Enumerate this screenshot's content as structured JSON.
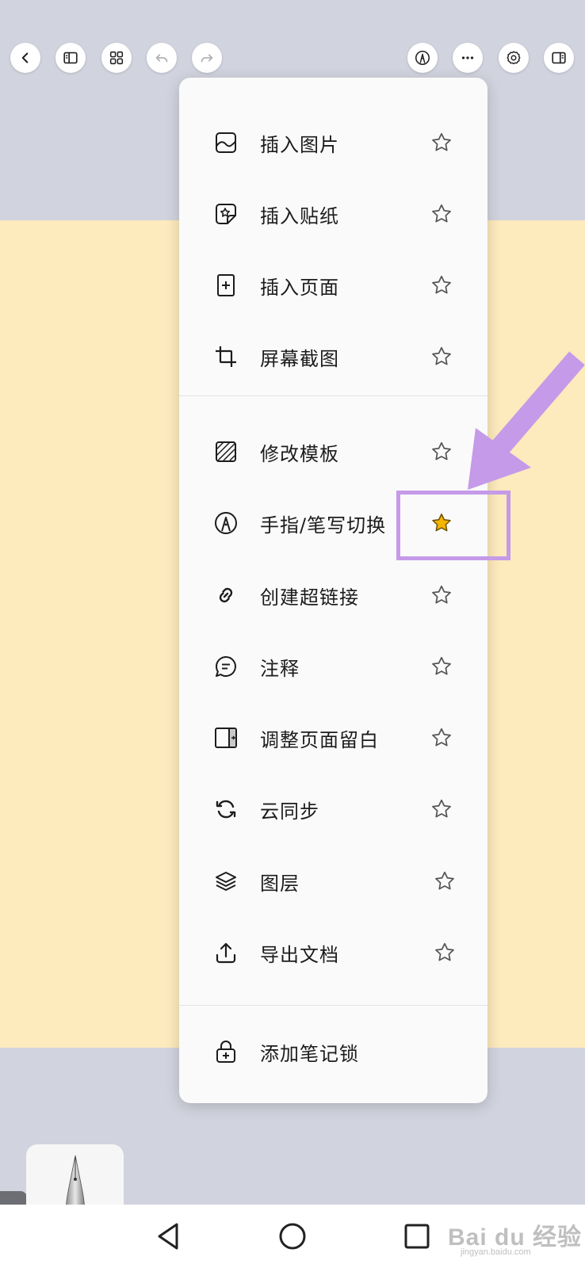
{
  "toolbar": {
    "left_buttons": [
      "back-icon",
      "sidebar-icon",
      "grid-icon",
      "undo-icon",
      "redo-icon"
    ],
    "right_buttons": [
      "pen-mode-icon",
      "more-icon",
      "settings-icon",
      "panel-icon"
    ]
  },
  "menu": {
    "items": [
      {
        "icon": "image-icon",
        "label": "插入图片",
        "favorite": false
      },
      {
        "icon": "sticker-icon",
        "label": "插入贴纸",
        "favorite": false
      },
      {
        "icon": "add-page-icon",
        "label": "插入页面",
        "favorite": false
      },
      {
        "icon": "crop-icon",
        "label": "屏幕截图",
        "favorite": false
      },
      {
        "icon": "template-icon",
        "label": "修改模板",
        "favorite": false
      },
      {
        "icon": "pen-nib-icon",
        "label": "手指/笔写切换",
        "favorite": true
      },
      {
        "icon": "link-icon",
        "label": "创建超链接",
        "favorite": false
      },
      {
        "icon": "comment-icon",
        "label": "注释",
        "favorite": false
      },
      {
        "icon": "margin-icon",
        "label": "调整页面留白",
        "favorite": false
      },
      {
        "icon": "sync-icon",
        "label": "云同步",
        "favorite": false
      },
      {
        "icon": "layers-icon",
        "label": "图层",
        "favorite": false
      },
      {
        "icon": "export-icon",
        "label": "导出文档",
        "favorite": false
      },
      {
        "icon": "lock-icon",
        "label": "添加笔记锁",
        "favorite": null
      }
    ]
  },
  "colors": {
    "paper": "#fdeabd",
    "background": "#d1d3de",
    "favorite_star": "#f4b400",
    "highlight": "#c59ae8"
  },
  "watermark": {
    "main": "Bai du 经验",
    "sub": "jingyan.baidu.com"
  }
}
